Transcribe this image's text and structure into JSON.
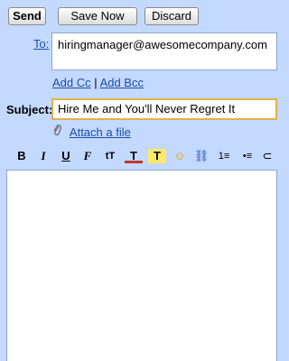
{
  "toolbar_top": {
    "send_label": "Send",
    "save_label": "Save Now",
    "discard_label": "Discard"
  },
  "to": {
    "label": "To:",
    "value": "hiringmanager@awesomecompany.com"
  },
  "cc_links": {
    "add_cc": "Add Cc",
    "separator": "|",
    "add_bcc": "Add Bcc"
  },
  "subject": {
    "label": "Subject:",
    "value": "Hire Me and You'll Never Regret It"
  },
  "attach": {
    "label": "Attach a file",
    "icon": "paperclip-icon"
  },
  "format_toolbar": {
    "bold": "B",
    "italic": "I",
    "underline": "U",
    "font": "F",
    "size": "tT",
    "text_color": "T",
    "highlight": "T",
    "emoji": "☺",
    "link": "⛓",
    "numbered_list": "1≡",
    "bullet_list": "•≡",
    "more": "⊂"
  },
  "colors": {
    "background": "#c3d9ff",
    "link": "#1a4ea6",
    "subject_focus_border": "#e3b04a"
  }
}
